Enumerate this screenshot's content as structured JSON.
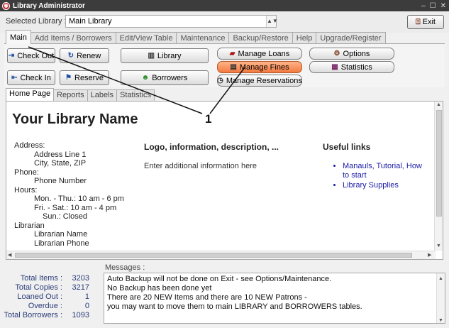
{
  "window": {
    "title": "Library Administrator"
  },
  "library": {
    "label": "Selected Library :",
    "selected": "Main Library",
    "exit_label": "Exit"
  },
  "main_tabs": [
    {
      "label": "Main",
      "active": true
    },
    {
      "label": "Add Items / Borrowers"
    },
    {
      "label": "Edit/View Table"
    },
    {
      "label": "Maintenance"
    },
    {
      "label": "Backup/Restore"
    },
    {
      "label": "Help"
    },
    {
      "label": "Upgrade/Register"
    }
  ],
  "buttons": {
    "check_out": "Check Out",
    "renew": "Renew",
    "library": "Library",
    "check_in": "Check In",
    "reserve": "Reserve",
    "borrowers": "Borrowers",
    "manage_loans": "Manage Loans",
    "manage_fines": "Manage Fines",
    "manage_reservations": "Manage Reservations",
    "options": "Options",
    "statistics": "Statistics"
  },
  "sub_tabs": [
    {
      "label": "Home Page",
      "active": true
    },
    {
      "label": "Reports"
    },
    {
      "label": "Labels"
    },
    {
      "label": "Statistics"
    }
  ],
  "home": {
    "title": "Your Library Name",
    "address_label": "Address:",
    "address_line": "Address Line 1",
    "city": "City, State, ZIP",
    "phone_label": "Phone:",
    "phone": "Phone Number",
    "hours_label": "Hours:",
    "hours": [
      "Mon. - Thu.: 10 am - 6 pm",
      "Fri. - Sat.: 10 am - 4 pm",
      "Sun.: Closed"
    ],
    "librarian_label": "Librarian",
    "librarian_name": "Librarian Name",
    "librarian_phone": "Librarian Phone",
    "logo_heading": "Logo, information, description, ...",
    "logo_text": "Enter additional information here",
    "links_heading": "Useful links",
    "links": [
      "Manauls, Tutorial, How to start",
      "Library Supplies"
    ]
  },
  "annotation": {
    "label": "1"
  },
  "messages": {
    "label": "Messages :",
    "lines": [
      "Auto Backup will not be done on Exit - see Options/Maintenance.",
      "No Backup has been done yet",
      "There are 20 NEW Items and there are 10 NEW Patrons -",
      "you may want to move them to main LIBRARY and BORROWERS tables."
    ]
  },
  "stats": [
    {
      "label": "Total Items :",
      "value": "3203"
    },
    {
      "label": "Total Copies :",
      "value": "3217"
    },
    {
      "label": "Loaned Out :",
      "value": "1"
    },
    {
      "label": "Overdue :",
      "value": "0"
    },
    {
      "label": "Total Borrowers :",
      "value": "1093"
    }
  ],
  "colors": {
    "title_bar": "#3c3c3c",
    "highlight_button": "#f27a40",
    "link": "#1a1aa6",
    "stats_text": "#2c3e7a"
  }
}
